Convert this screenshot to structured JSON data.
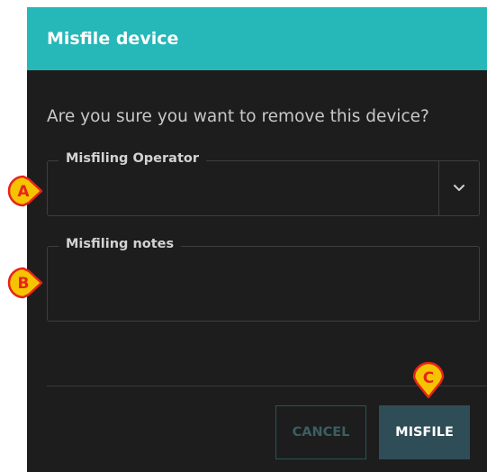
{
  "dialog": {
    "title": "Misfile device",
    "question": "Are you sure you want to remove this device?",
    "operator_field": {
      "label": "Misfiling Operator",
      "value": ""
    },
    "notes_field": {
      "label": "Misfiling notes",
      "value": ""
    },
    "buttons": {
      "cancel": "CANCEL",
      "misfile": "MISFILE"
    }
  },
  "callouts": [
    {
      "letter": "A"
    },
    {
      "letter": "B"
    },
    {
      "letter": "C"
    }
  ],
  "colors": {
    "header": "#26b7b8",
    "dialog_bg": "#1d1d1d",
    "callout_fill": "#f5c400",
    "callout_border": "#e8231c",
    "callout_text": "#e8231c"
  }
}
